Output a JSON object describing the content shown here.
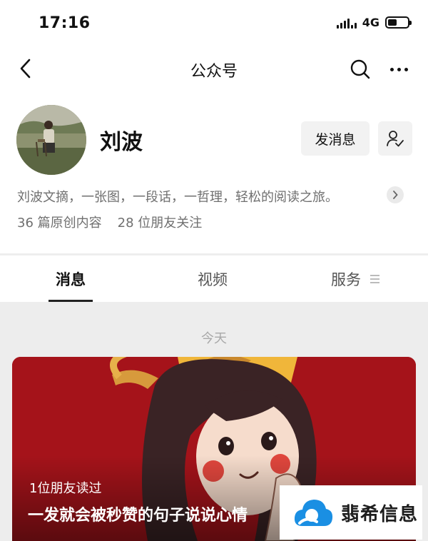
{
  "status_bar": {
    "time": "17:16",
    "network": "4G",
    "battery_level": 0.45
  },
  "nav": {
    "title": "公众号",
    "back_icon": "chevron-left-icon",
    "search_icon": "search-icon",
    "more_icon": "more-dots-icon"
  },
  "profile": {
    "name": "刘波",
    "send_message_label": "发消息",
    "follow_icon": "user-check-icon",
    "description": "刘波文摘，一张图，一段话，一哲理，轻松的阅读之旅。",
    "original_count": "36 篇原创内容",
    "friends_following": "28 位朋友关注"
  },
  "tabs": [
    {
      "label": "消息",
      "active": true
    },
    {
      "label": "视频",
      "active": false
    },
    {
      "label": "服务",
      "active": false
    }
  ],
  "feed": {
    "date_label": "今天",
    "article": {
      "read_count": "1位朋友读过",
      "title": "一发就会被秒赞的句子说说心情"
    }
  },
  "watermark": {
    "text": "翡希信息"
  },
  "colors": {
    "cover_red": "#a5131a",
    "accent_blue": "#1a8fe3"
  }
}
